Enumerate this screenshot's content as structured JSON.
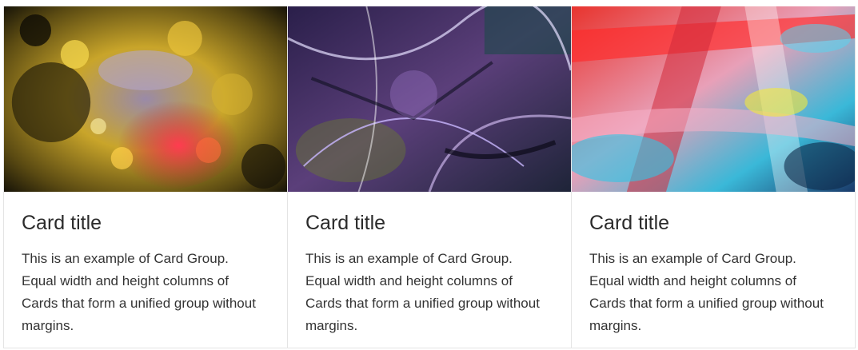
{
  "cards": [
    {
      "image_name": "oil-bubbles-image",
      "title": "Card title",
      "text": "This is an example of Card Group. Equal width and height columns of Cards that form a unified group without margins."
    },
    {
      "image_name": "purple-abstract-image",
      "title": "Card title",
      "text": "This is an example of Card Group. Equal width and height columns of Cards that form a unified group without margins."
    },
    {
      "image_name": "paint-strokes-image",
      "title": "Card title",
      "text": "This is an example of Card Group. Equal width and height columns of Cards that form a unified group without margins."
    }
  ],
  "colors": {
    "border": "#e4e4e4",
    "title": "#2b2b2b",
    "text": "#333333"
  }
}
